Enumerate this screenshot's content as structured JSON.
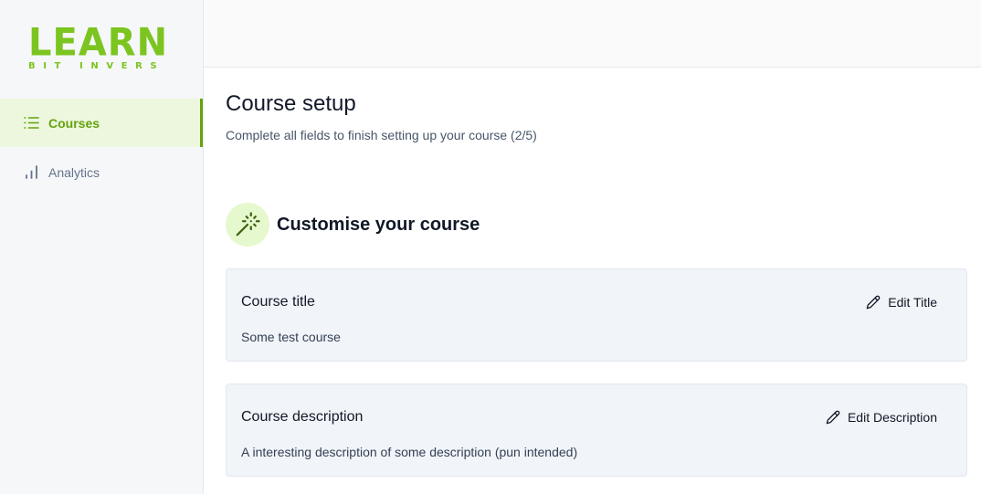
{
  "brand": {
    "name": "LEARN",
    "tagline": "BIT INVERS",
    "color": "#7cc41f"
  },
  "sidebar": {
    "items": [
      {
        "label": "Courses",
        "icon": "list-icon",
        "active": true
      },
      {
        "label": "Analytics",
        "icon": "bar-chart-icon",
        "active": false
      }
    ]
  },
  "page": {
    "title": "Course setup",
    "subtitle": "Complete all fields to finish setting up your course (2/5)"
  },
  "section": {
    "title": "Customise your course",
    "icon": "magic-wand-icon"
  },
  "fields": [
    {
      "label": "Course title",
      "value": "Some test course",
      "action_label": "Edit Title",
      "action_icon": "pencil-icon"
    },
    {
      "label": "Course description",
      "value": "A interesting description of some description (pun intended)",
      "action_label": "Edit Description",
      "action_icon": "pencil-icon"
    }
  ],
  "colors": {
    "accent": "#65a30d",
    "active_bg": "#ecf7dd",
    "card_bg": "#f1f4f8",
    "icon_bg": "#e6f8cd"
  }
}
